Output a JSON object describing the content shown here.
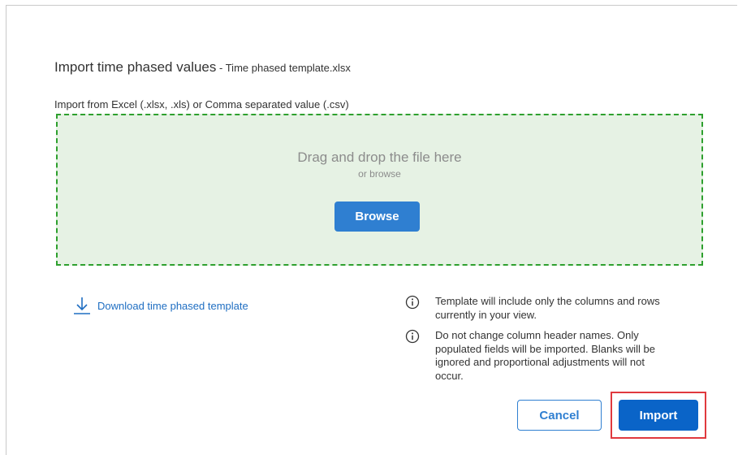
{
  "dialog": {
    "title": "Import time phased values",
    "title_separator": " - ",
    "file_name": "Time phased template.xlsx",
    "import_from_label": "Import from Excel (.xlsx, .xls) or Comma separated value (.csv)"
  },
  "dropzone": {
    "title": "Drag and drop the file here",
    "subtitle": "or browse",
    "browse_label": "Browse",
    "border_color": "#2ea02e",
    "background_color": "#e6f2e4"
  },
  "download": {
    "label": "Download time phased template",
    "icon": "download-icon"
  },
  "notes": [
    {
      "icon": "info-icon",
      "text": "Template will include only the columns and rows currently in your view."
    },
    {
      "icon": "info-icon",
      "text": "Do not change column header names. Only populated fields will be imported. Blanks will be ignored and proportional adjustments will not occur."
    }
  ],
  "actions": {
    "cancel_label": "Cancel",
    "import_label": "Import",
    "primary_color": "#0a64c8",
    "highlight_color": "#e0393e"
  }
}
